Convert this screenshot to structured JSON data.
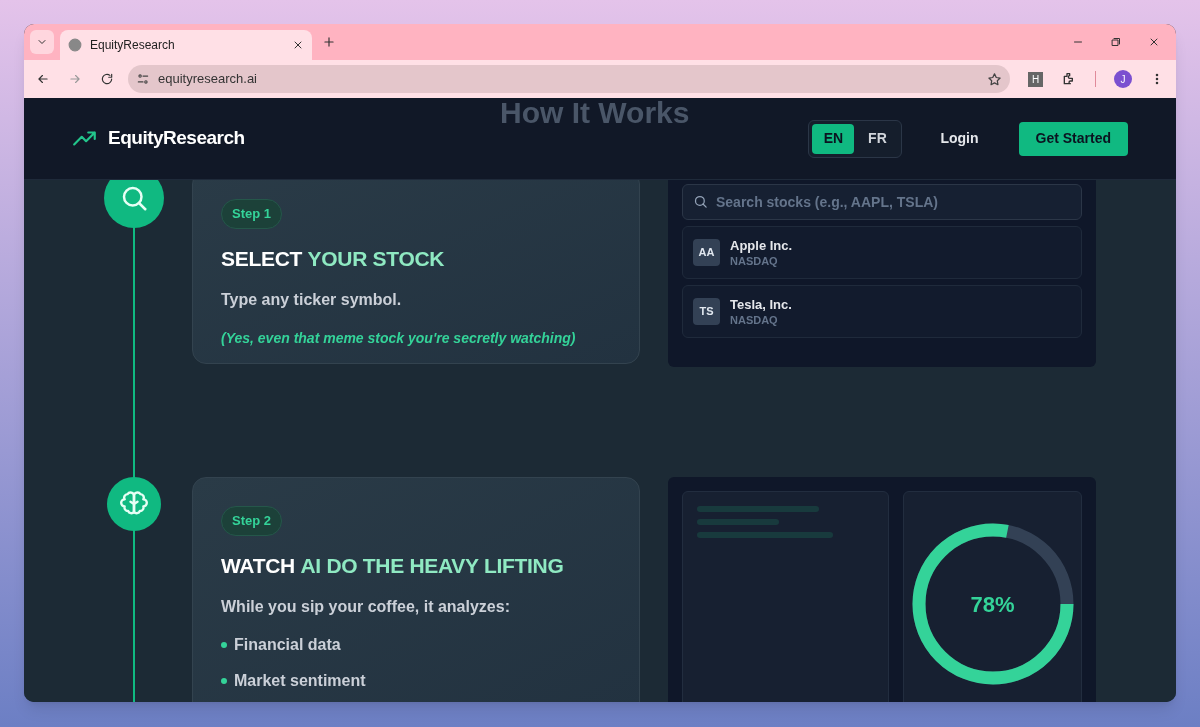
{
  "browser": {
    "tab_title": "EquityResearch",
    "url": "equityresearch.ai",
    "profile_initial": "J",
    "extension_letter": "H"
  },
  "header": {
    "logo": "EquityResearch",
    "section_title": "How It Works",
    "languages": [
      {
        "label": "EN",
        "selected": true
      },
      {
        "label": "FR",
        "selected": false
      }
    ],
    "login": "Login",
    "cta": "Get Started"
  },
  "steps": [
    {
      "badge": "Step 1",
      "title": "SELECT **YOUR STOCK**",
      "text": "Type any ticker symbol.",
      "note": "(Yes, even that meme stock you're secretly watching)",
      "preview": {
        "kind": "search",
        "placeholder": "Search stocks (e.g., AAPL, TSLA)",
        "results": [
          {
            "initials": "AA",
            "name": "Apple Inc.",
            "exchange": "NASDAQ"
          },
          {
            "initials": "TS",
            "name": "Tesla, Inc.",
            "exchange": "NASDAQ"
          }
        ]
      }
    },
    {
      "badge": "Step 2",
      "title": "WATCH **AI DO THE HEAVY LIFTING**",
      "text": "While you sip your coffee, it analyzes:",
      "bullets": [
        "Financial data",
        "Market sentiment"
      ],
      "preview": {
        "kind": "progress",
        "level": 0.78,
        "reading": "78%"
      }
    }
  ]
}
